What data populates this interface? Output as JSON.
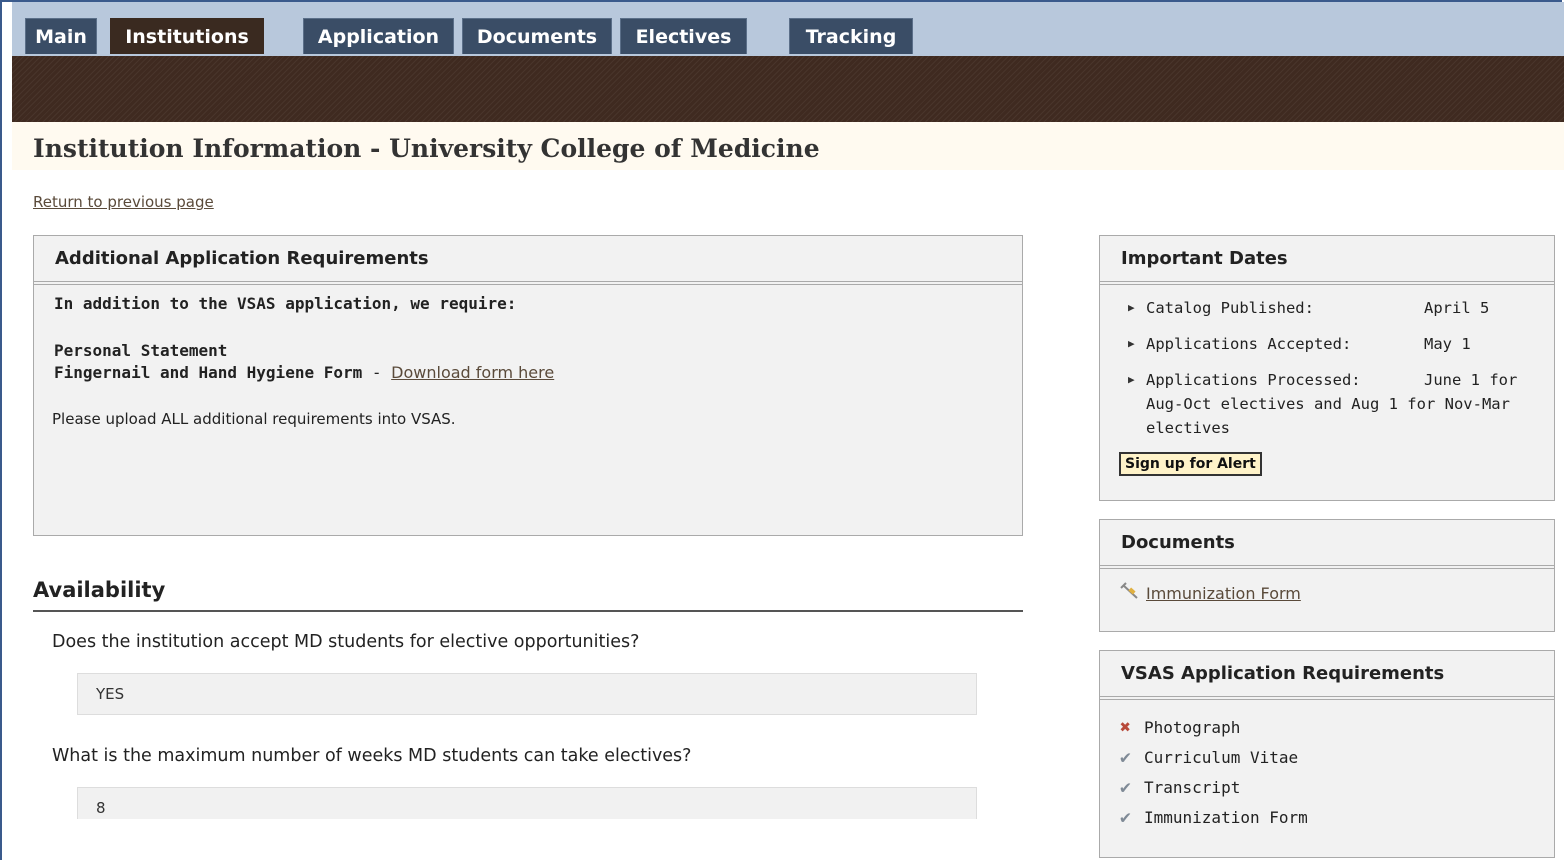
{
  "tabs": [
    {
      "label": "Main"
    },
    {
      "label": "Institutions"
    },
    {
      "label": "Application"
    },
    {
      "label": "Documents"
    },
    {
      "label": "Electives"
    },
    {
      "label": "Tracking"
    }
  ],
  "active_tab": "Institutions",
  "page": {
    "title": "Institution Information - University College of Medicine",
    "return_link": "Return to previous page"
  },
  "additional_requirements": {
    "heading": "Additional Application Requirements",
    "intro": "In addition to the VSAS application, we require:",
    "item1": "Personal Statement",
    "item2": "Fingernail and Hand Hygiene Form",
    "item2_separator": " - ",
    "item2_link": "Download form here",
    "note": "Please upload ALL additional requirements into VSAS."
  },
  "availability": {
    "heading": "Availability",
    "q1": "Does the institution accept MD students for elective opportunities?",
    "a1": "YES",
    "q2": "What is the maximum number of weeks MD students can take electives?",
    "a2": "8"
  },
  "important_dates": {
    "heading": "Important Dates",
    "rows": [
      {
        "label": "Catalog Published:",
        "value": "April 5"
      },
      {
        "label": "Applications Accepted:",
        "value": "May 1"
      },
      {
        "label": "Applications Processed:",
        "value": "June 1 for",
        "continuation": "Aug-Oct electives and Aug 1 for Nov-Mar electives"
      }
    ],
    "alert_button": "Sign up for Alert"
  },
  "documents": {
    "heading": "Documents",
    "link": "Immunization Form",
    "icon": "syringe-icon"
  },
  "vsas_requirements": {
    "heading": "VSAS Application Requirements",
    "items": [
      {
        "label": "Photograph",
        "status": "missing"
      },
      {
        "label": "Curriculum Vitae",
        "status": "complete"
      },
      {
        "label": "Transcript",
        "status": "complete"
      },
      {
        "label": "Immunization Form",
        "status": "complete"
      }
    ]
  },
  "colors": {
    "tab_bg": "#3a4d66",
    "tab_active_bg": "#3a2a20",
    "band": "#3f2a20",
    "top_bar": "#b8c8dc",
    "missing": "#b84a3a",
    "complete": "#7f8a96"
  }
}
